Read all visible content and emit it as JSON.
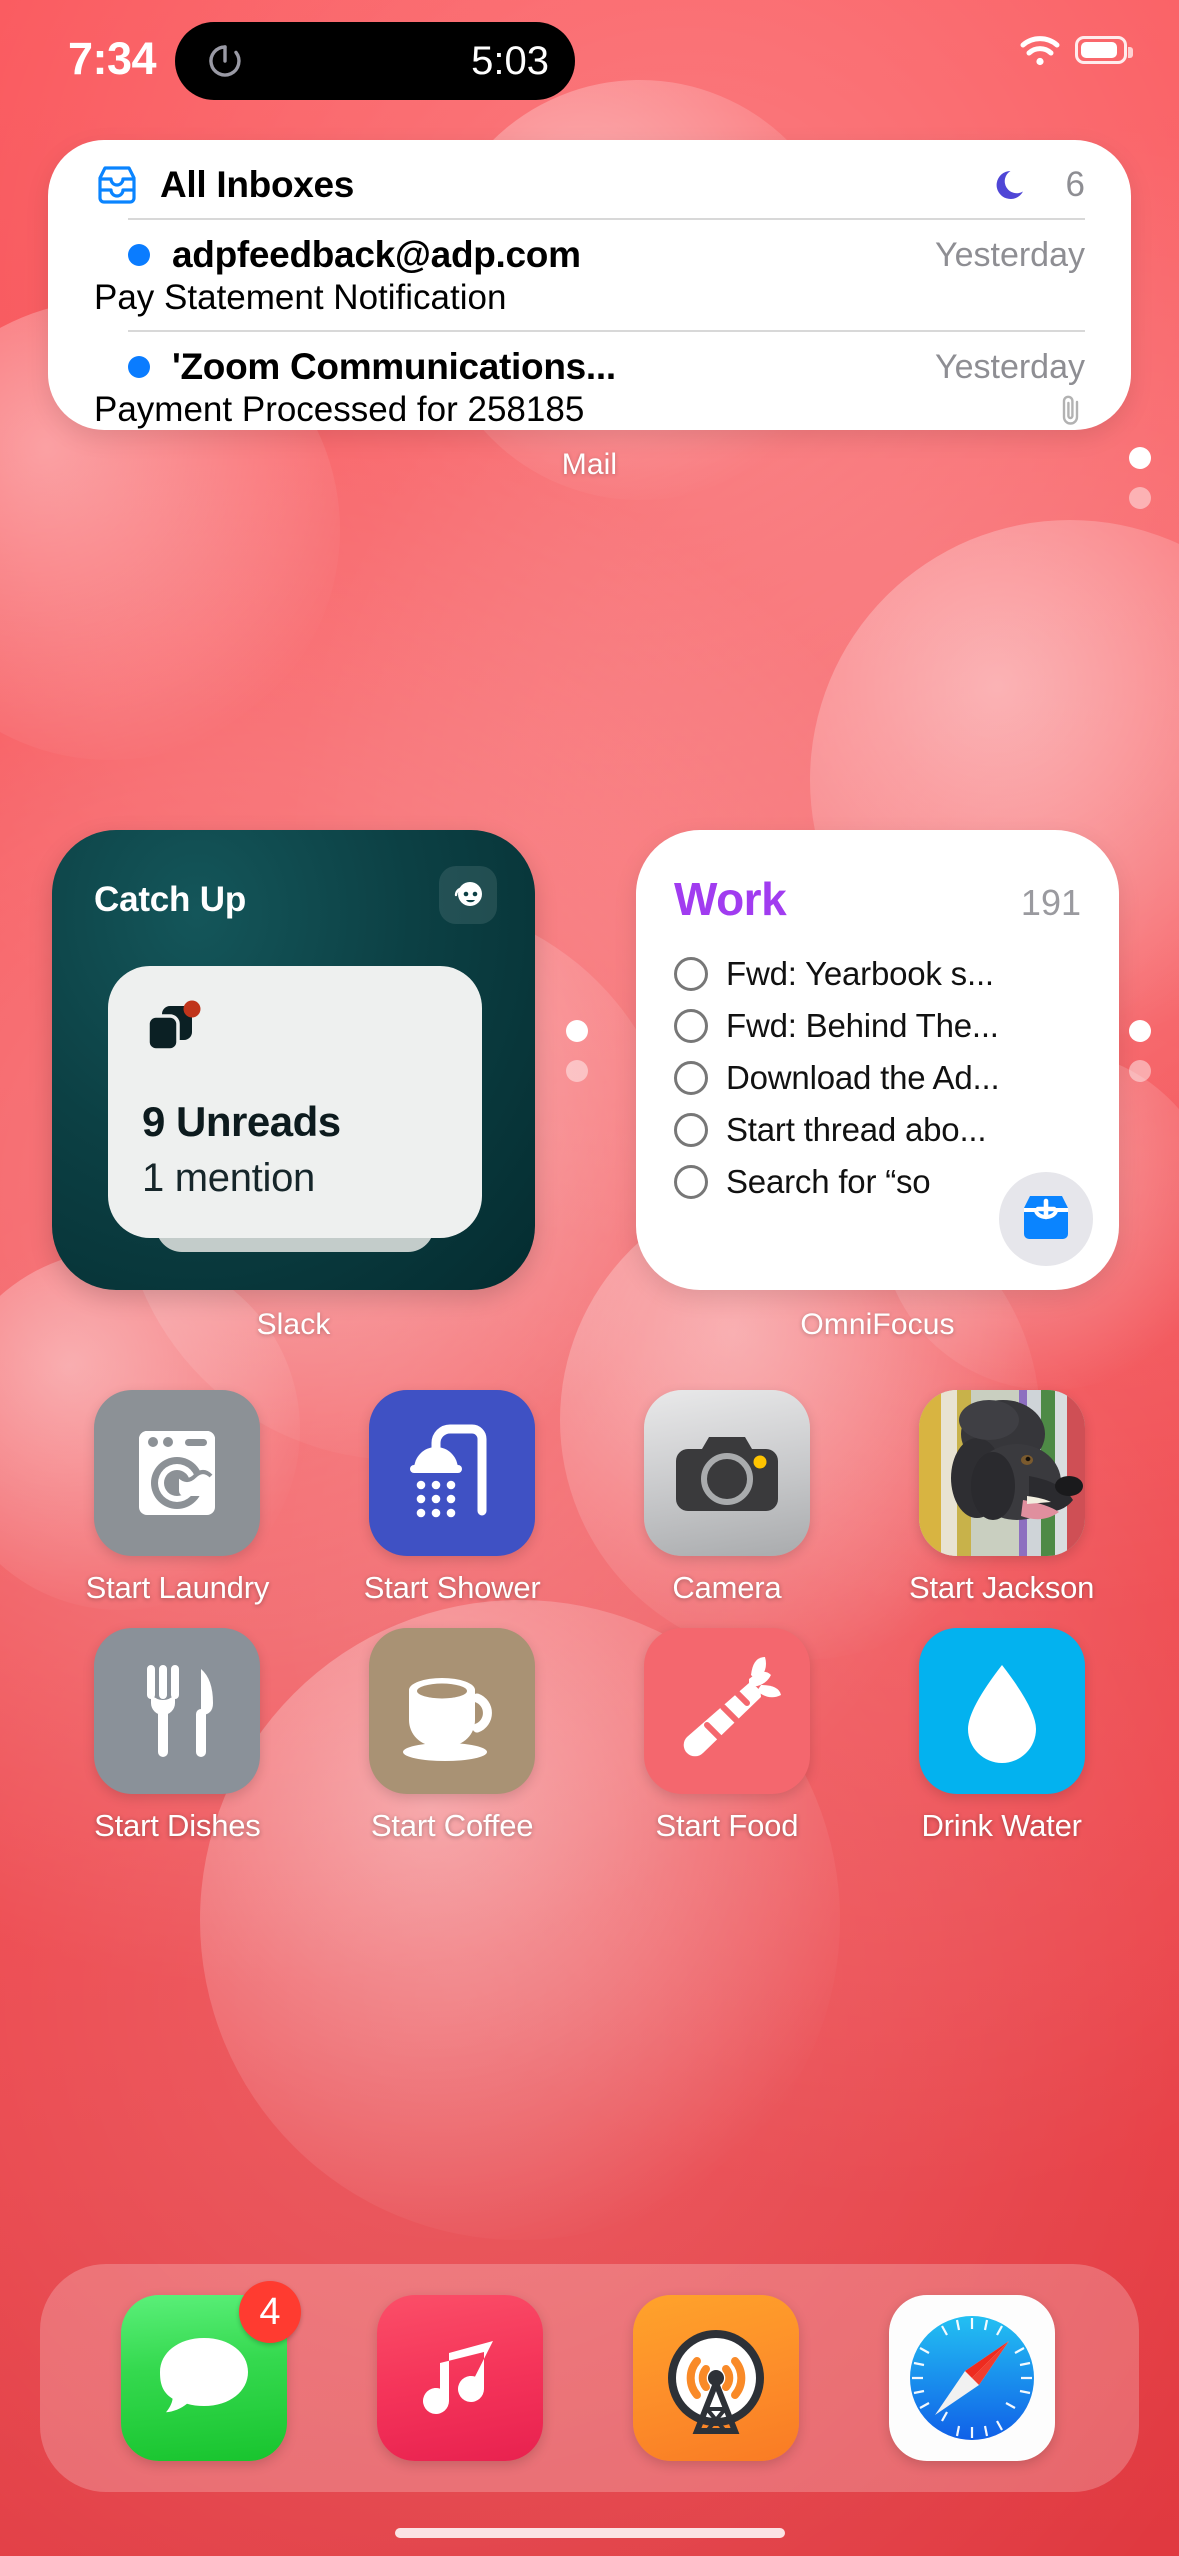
{
  "status_bar": {
    "time": "7:34",
    "dynamic_island": {
      "timer_icon": "timer-icon",
      "countdown": "5:03"
    },
    "wifi_icon": "wifi-icon",
    "battery_icon": "battery-icon"
  },
  "page_indicator": {
    "total": 2,
    "active_index": 0
  },
  "mail_widget": {
    "label": "Mail",
    "inbox_icon": "inbox-tray-icon",
    "title": "All Inboxes",
    "focus_icon": "crescent-moon-icon",
    "count": "6",
    "messages": [
      {
        "unread": true,
        "from": "adpfeedback@adp.com",
        "date": "Yesterday",
        "subject": "Pay Statement Notification",
        "has_attachment": false
      },
      {
        "unread": true,
        "from": "'Zoom Communications...",
        "date": "Yesterday",
        "subject": "Payment Processed for 258185",
        "has_attachment": true
      }
    ]
  },
  "slack_widget": {
    "label": "Slack",
    "title": "Catch Up",
    "avatar_icon": "astronaut-avatar-icon",
    "stack_icon": "card-stack-icon",
    "unreads": "9 Unreads",
    "mentions": "1 mention"
  },
  "omnifocus_widget": {
    "label": "OmniFocus",
    "title": "Work",
    "title_color": "#a13cf0",
    "count": "191",
    "items": [
      "Fwd: Yearbook s...",
      "Fwd: Behind The...",
      "Download the Ad...",
      "Start thread abo...",
      "Search for “so"
    ],
    "add_button_icon": "inbox-plus-icon"
  },
  "app_rows": [
    [
      {
        "label": "Start Laundry",
        "icon": "washing-machine-icon",
        "bg": "#8c9196"
      },
      {
        "label": "Start Shower",
        "icon": "shower-icon",
        "bg": "#3f51c4"
      },
      {
        "label": "Camera",
        "icon": "camera-icon",
        "bg": "#c7c8ca"
      },
      {
        "label": "Start Jackson",
        "icon": "dog-photo-icon",
        "bg": "#8e9f6e"
      }
    ],
    [
      {
        "label": "Start Dishes",
        "icon": "fork-knife-icon",
        "bg": "#8a9199"
      },
      {
        "label": "Start Coffee",
        "icon": "coffee-cup-icon",
        "bg": "#a99274"
      },
      {
        "label": "Start Food",
        "icon": "carrot-icon",
        "bg": "#f4676e"
      },
      {
        "label": "Drink Water",
        "icon": "water-drop-icon",
        "bg": "#03b2ef"
      }
    ]
  ],
  "dock": [
    {
      "label": "Messages",
      "icon": "messages-icon",
      "badge": "4"
    },
    {
      "label": "Music",
      "icon": "music-note-icon",
      "badge": ""
    },
    {
      "label": "Overcast",
      "icon": "radio-tower-icon",
      "badge": ""
    },
    {
      "label": "Safari",
      "icon": "safari-compass-icon",
      "badge": ""
    }
  ]
}
